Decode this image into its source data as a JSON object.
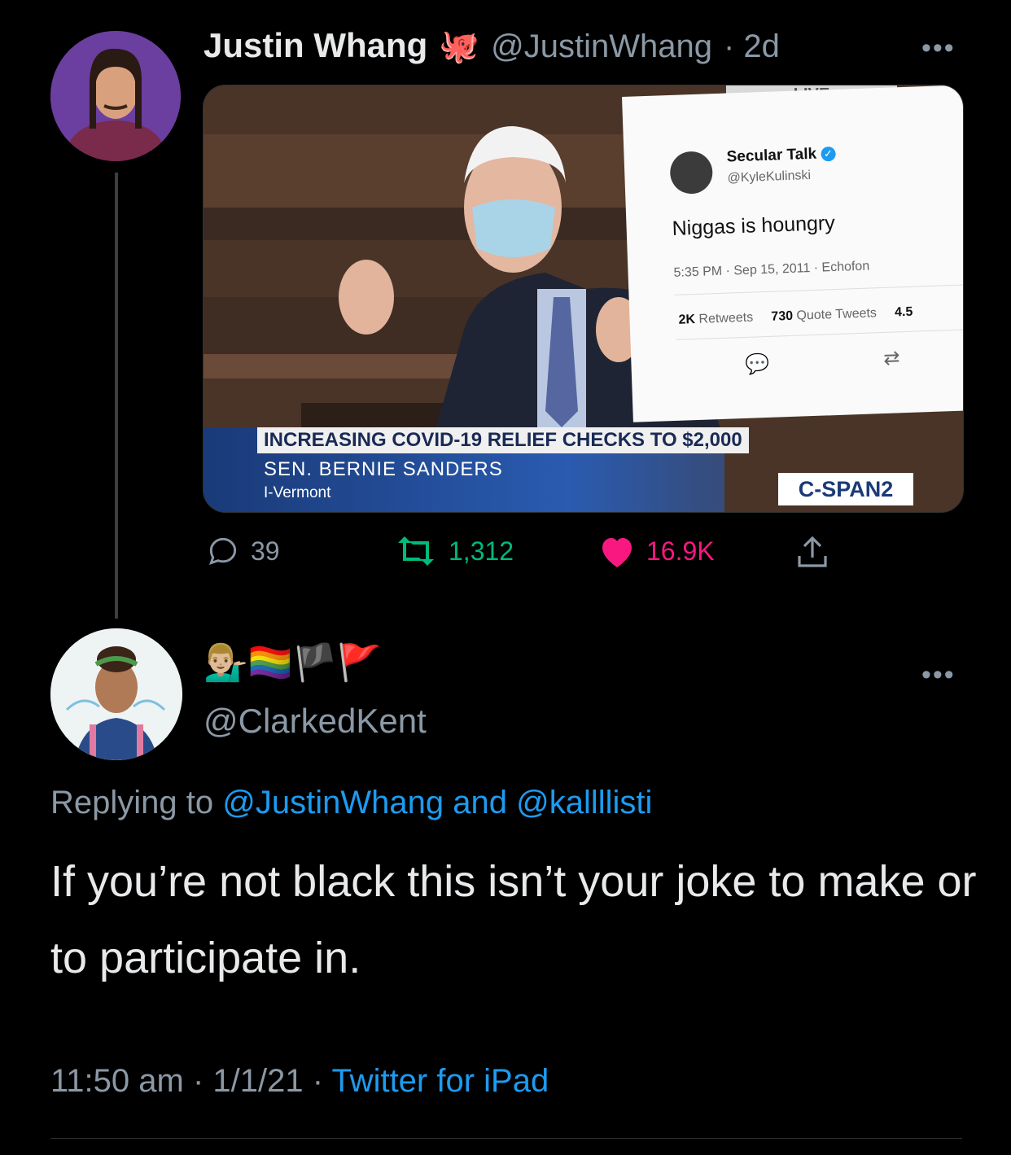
{
  "first_tweet": {
    "author_name": "Justin Whang",
    "author_emoji": "🐙",
    "handle": "@JustinWhang",
    "time_ago": "· 2d",
    "more": "•••",
    "media": {
      "live_label": "LIVE",
      "embedded_tweet": {
        "name": "Secular Talk",
        "handle": "@KyleKulinski",
        "text": "Niggas is houngry",
        "meta": "5:35 PM · Sep 15, 2011 · Echofon",
        "retweets_num": "2K",
        "retweets_label": "Retweets",
        "quotes_num": "730",
        "quotes_label": "Quote Tweets",
        "likes_num": "4.5"
      },
      "chyron_headline": "INCREASING COVID-19 RELIEF CHECKS TO $2,000",
      "chyron_name": "SEN. BERNIE SANDERS",
      "chyron_state": "I-Vermont",
      "network": "C-SPAN2"
    },
    "stats": {
      "replies": "39",
      "retweets": "1,312",
      "likes": "16.9K"
    },
    "colors": {
      "retweet": "#00ba7c",
      "like": "#f91880"
    }
  },
  "reply_tweet": {
    "display_name_emojis": "💁🏼‍♂️🏳️‍🌈🏴🚩",
    "handle": "@ClarkedKent",
    "more": "•••",
    "replying_prefix": "Replying to",
    "replying_to_1": "@JustinWhang",
    "replying_and": "and",
    "replying_to_2": "@kallllisti",
    "text": "If you’re not black this isn’t your joke to make or to participate in.",
    "time": "11:50 am",
    "sep1": "·",
    "date": "1/1/21",
    "sep2": "·",
    "client": "Twitter for iPad"
  }
}
